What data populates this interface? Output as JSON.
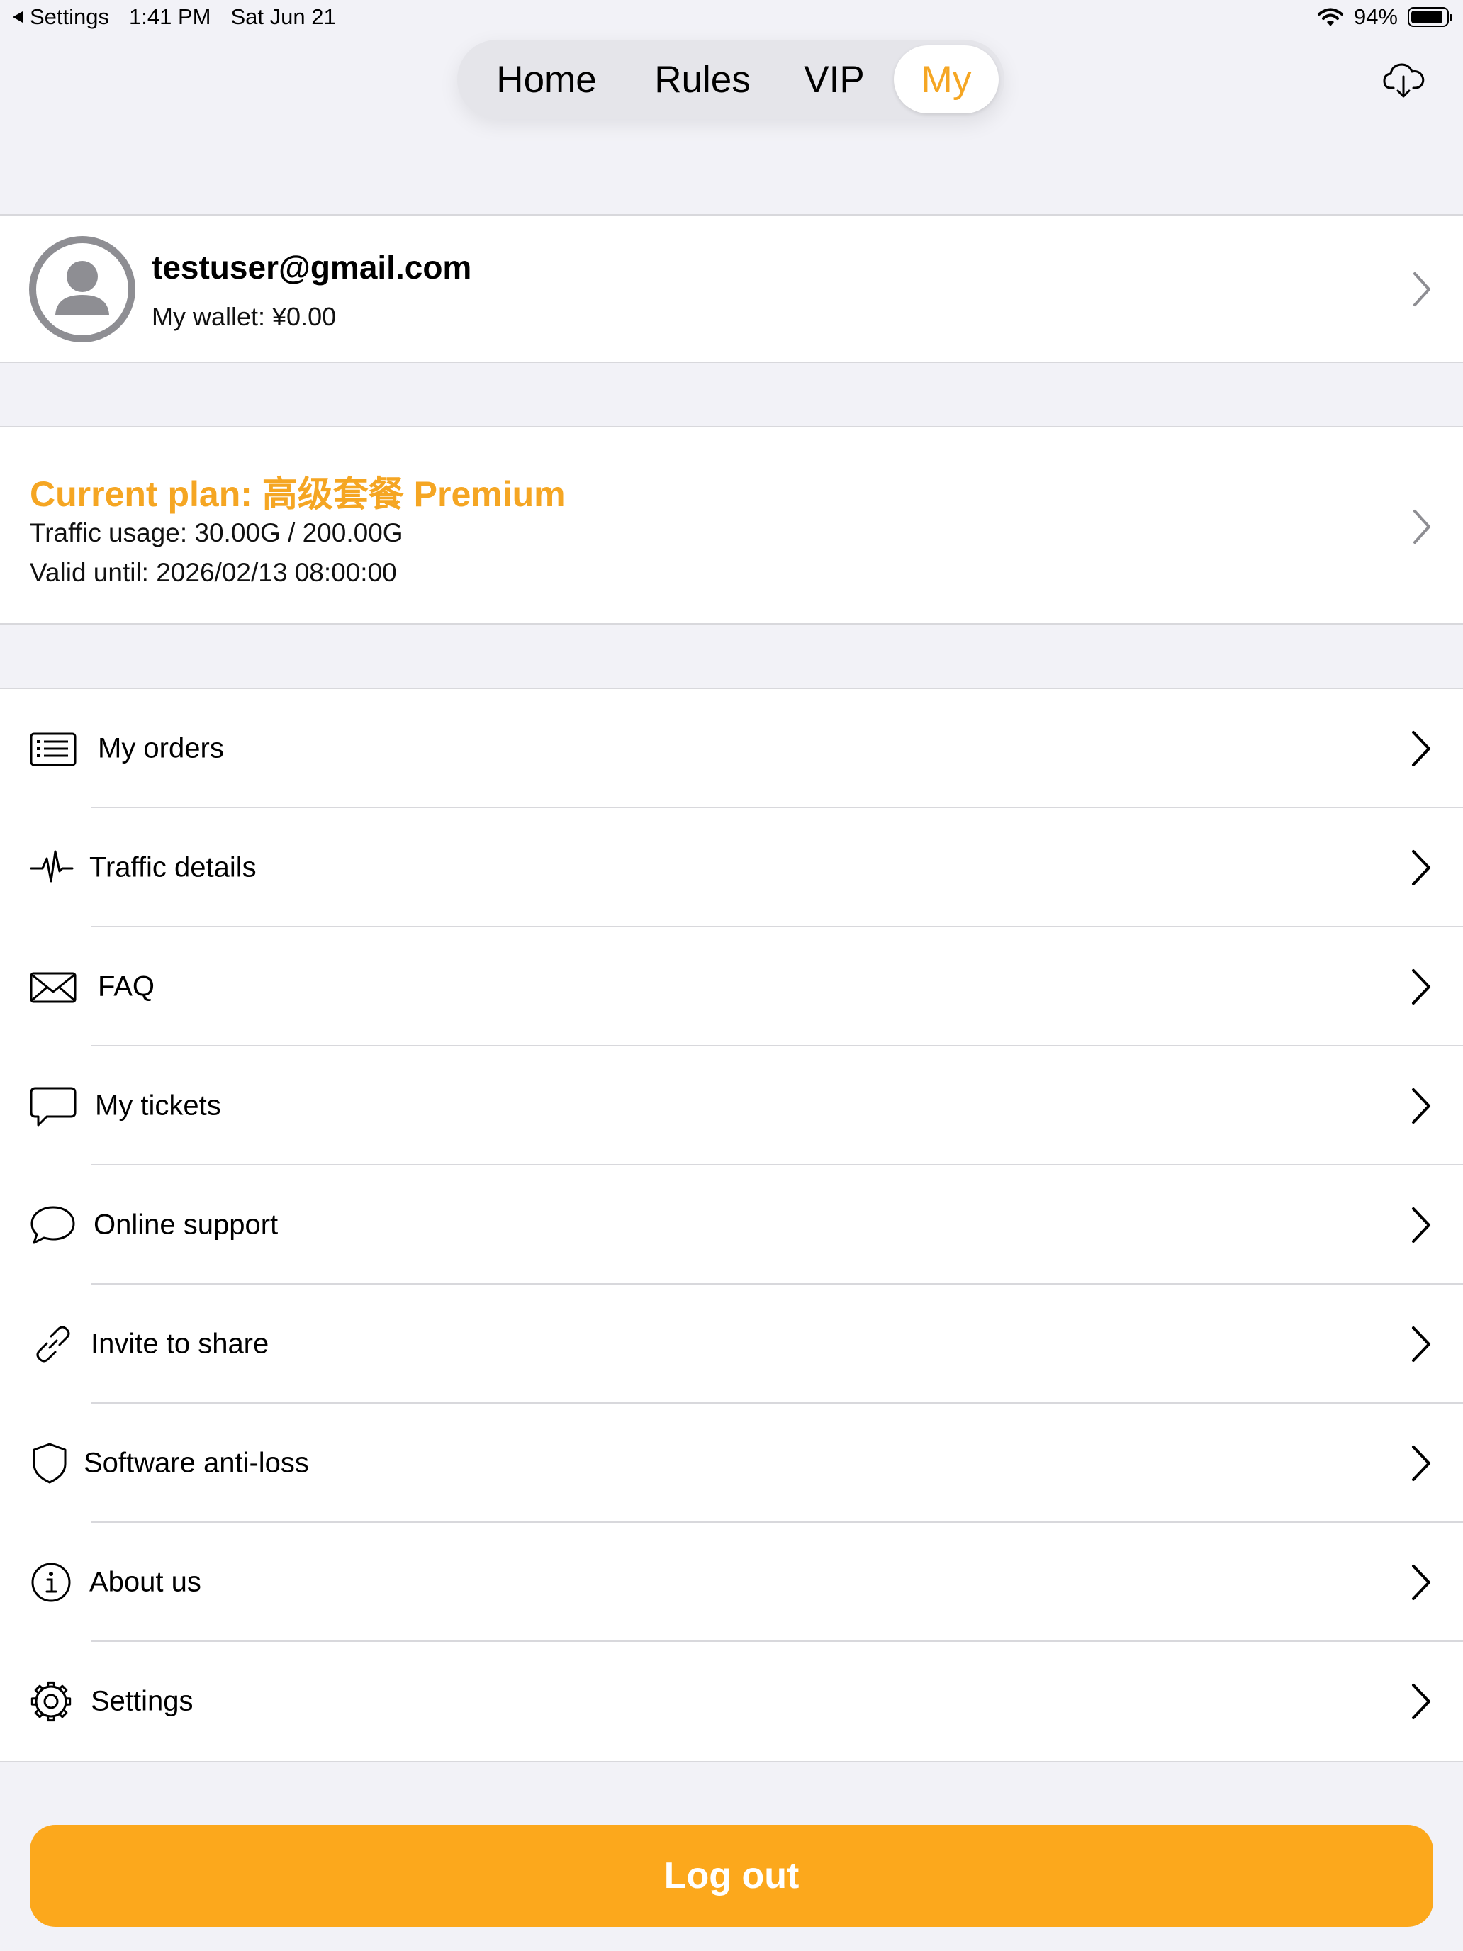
{
  "status_bar": {
    "back_label": "Settings",
    "time": "1:41 PM",
    "date": "Sat Jun 21",
    "battery": "94%",
    "battery_level": 0.94
  },
  "tabs": [
    {
      "label": "Home",
      "active": false
    },
    {
      "label": "Rules",
      "active": false
    },
    {
      "label": "VIP",
      "active": false
    },
    {
      "label": "My",
      "active": true
    }
  ],
  "profile": {
    "email": "testuser@gmail.com",
    "wallet": "My wallet: ¥0.00"
  },
  "plan": {
    "title": "Current plan: 高级套餐 Premium",
    "traffic": "Traffic usage: 30.00G / 200.00G",
    "valid_until": "Valid until: 2026/02/13 08:00:00"
  },
  "menu": [
    {
      "label": "My orders",
      "icon": "list-icon"
    },
    {
      "label": "Traffic details",
      "icon": "pulse-icon"
    },
    {
      "label": "FAQ",
      "icon": "envelope-icon"
    },
    {
      "label": "My tickets",
      "icon": "message-square-icon"
    },
    {
      "label": "Online support",
      "icon": "chat-bubble-icon"
    },
    {
      "label": "Invite to share",
      "icon": "link-icon"
    },
    {
      "label": "Software anti-loss",
      "icon": "shield-icon"
    },
    {
      "label": "About us",
      "icon": "info-icon"
    },
    {
      "label": "Settings",
      "icon": "gear-icon"
    }
  ],
  "logout_label": "Log out",
  "colors": {
    "accent": "#f5a623",
    "button": "#fca81c",
    "background": "#f2f2f7"
  }
}
